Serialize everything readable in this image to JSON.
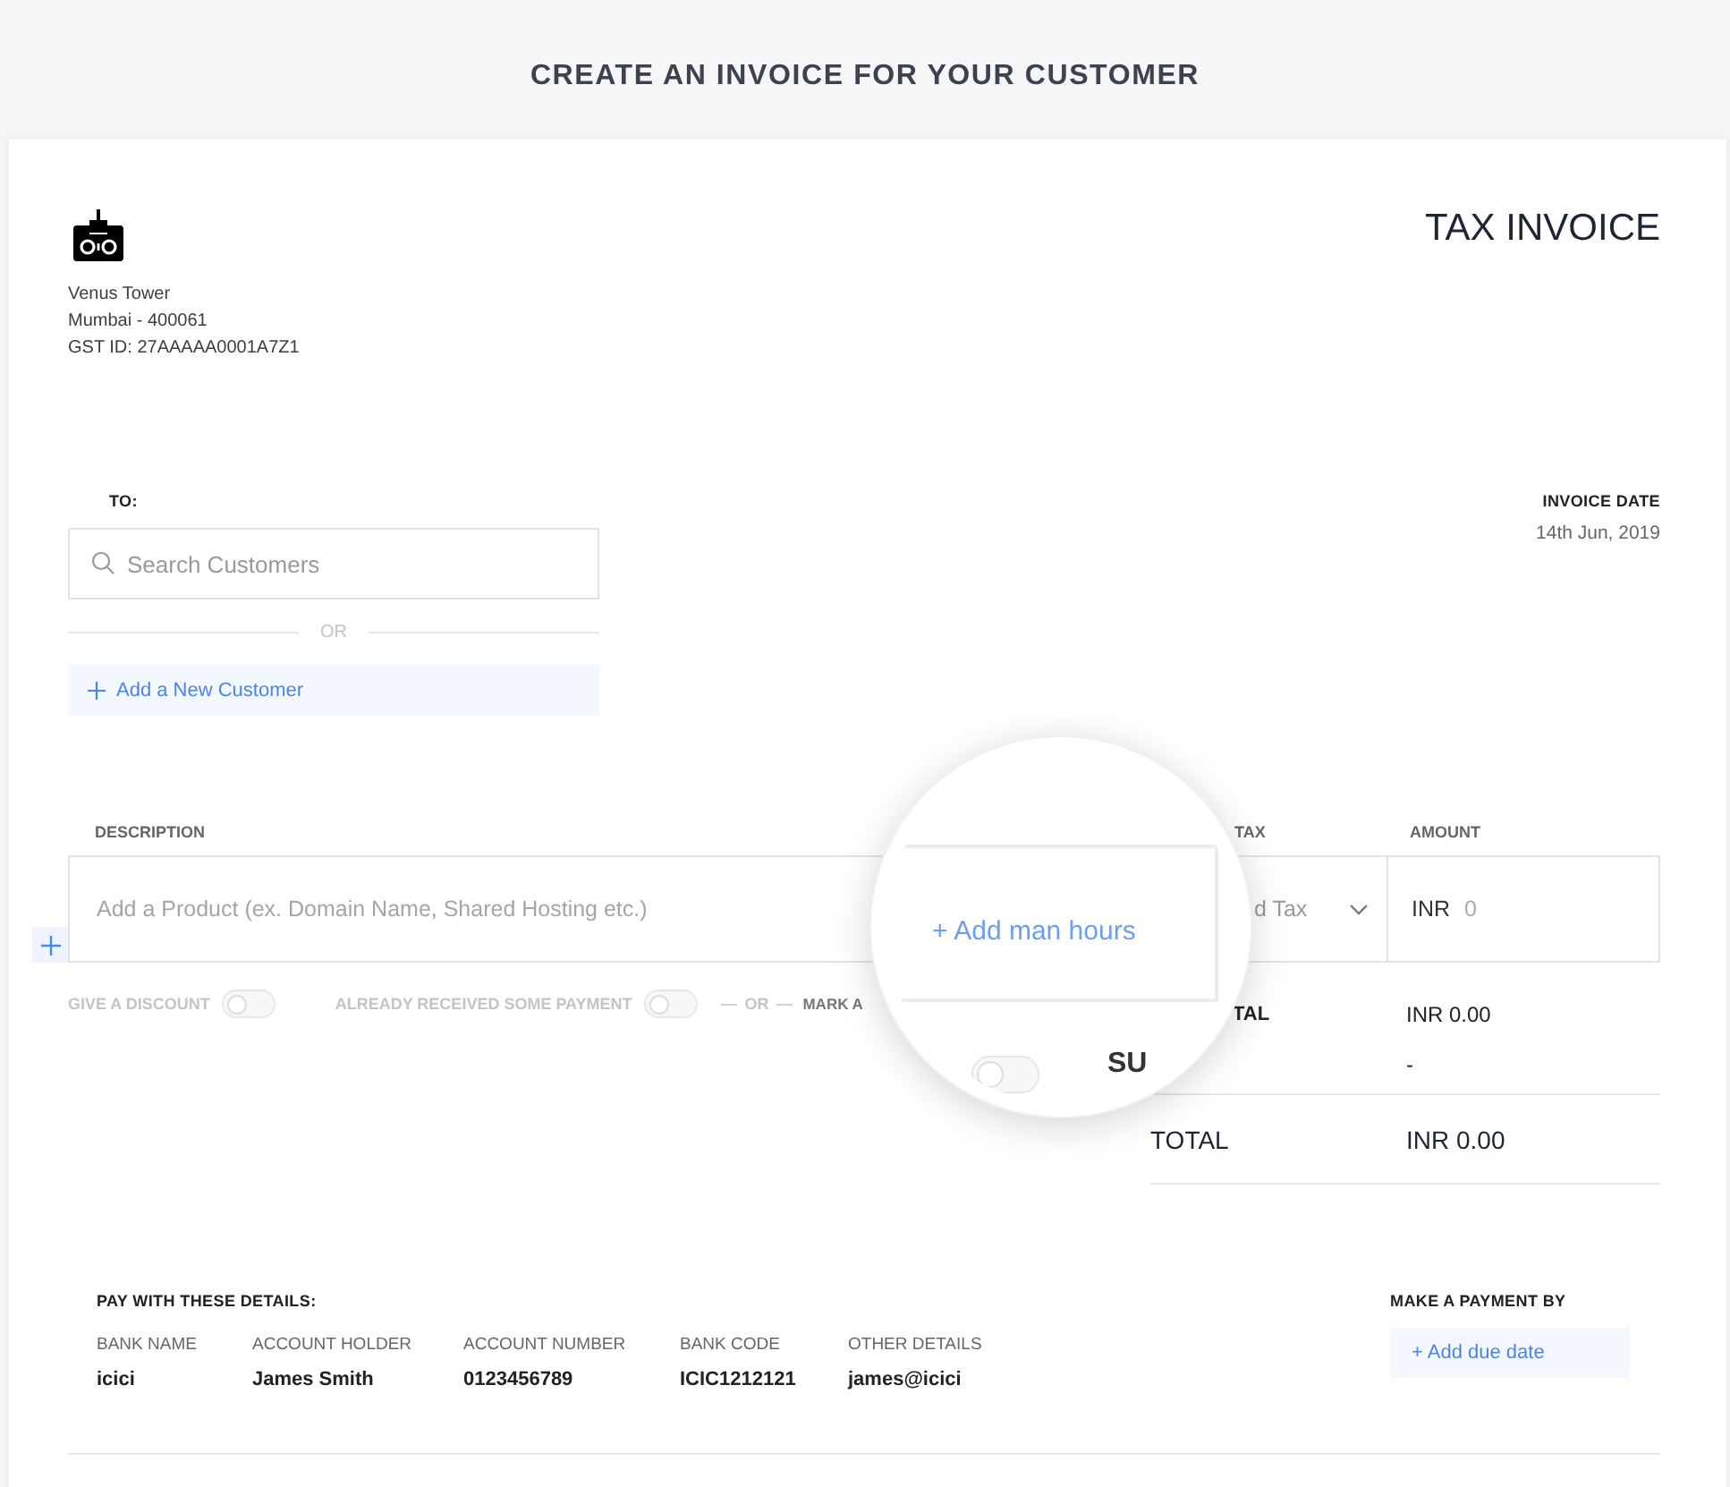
{
  "page_title": "CREATE AN INVOICE FOR YOUR CUSTOMER",
  "business": {
    "address_lines": [
      "Venus Tower",
      "Mumbai - 400061",
      "GST ID: 27AAAAA0001A7Z1"
    ]
  },
  "document_title": "TAX INVOICE",
  "customer": {
    "label": "TO:",
    "search": {
      "placeholder": "Search Customers"
    },
    "separator": "OR",
    "add_button": "Add a New Customer"
  },
  "invoice_date": {
    "label": "INVOICE DATE",
    "value": "14th Jun, 2019"
  },
  "items": {
    "columns": [
      {
        "label": "DESCRIPTION"
      },
      {
        "label": "TAX"
      },
      {
        "label": "AMOUNT"
      }
    ],
    "row": {
      "description_placeholder": "Add a Product (ex. Domain Name, Shared Hosting etc.)",
      "tax": "d Tax",
      "currency": "INR",
      "amount_placeholder": "0"
    }
  },
  "options": [
    {
      "label": "GIVE A DISCOUNT",
      "on": false
    },
    {
      "label": "ALREADY RECEIVED SOME PAYMENT",
      "on": false
    }
  ],
  "options_separator": "OR",
  "options_cut_label": "MARK A",
  "summary": {
    "rows": [
      {
        "label": "TAL",
        "value": "INR 0.00"
      },
      {
        "value": "-"
      }
    ],
    "total": {
      "label": "TOTAL",
      "value": "INR 0.00"
    }
  },
  "magnifier": {
    "button": "+ Add man hours",
    "toggle_on": false,
    "label": "SU"
  },
  "payment_details": {
    "title": "PAY WITH THESE DETAILS:",
    "fields": [
      {
        "label": "BANK NAME",
        "value": "icici"
      },
      {
        "label": "ACCOUNT HOLDER",
        "value": "James Smith"
      },
      {
        "label": "ACCOUNT NUMBER",
        "value": "0123456789"
      },
      {
        "label": "BANK CODE",
        "value": "ICIC1212121"
      },
      {
        "label": "OTHER DETAILS",
        "value": "james@icici"
      }
    ]
  },
  "due_date": {
    "title": "MAKE A PAYMENT BY",
    "button": "+ Add due date"
  }
}
